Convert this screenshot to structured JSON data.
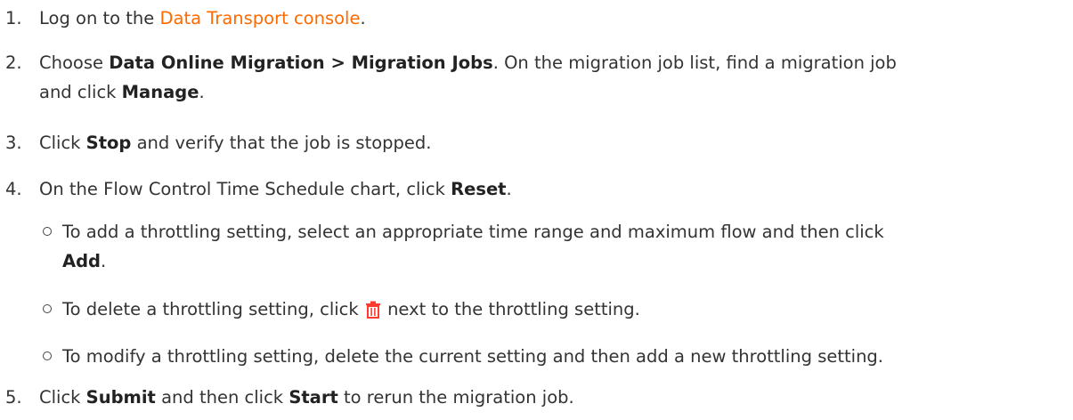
{
  "steps": [
    {
      "num": "1.",
      "t1": "Log on to the ",
      "link": "Data Transport console",
      "t2": "."
    },
    {
      "num": "2.",
      "t1": "Choose ",
      "b1": "Data Online Migration > Migration Jobs",
      "t2": ". On the migration job list, find a migration job",
      "t3": "and click ",
      "b2": "Manage",
      "t4": "."
    },
    {
      "num": "3.",
      "t1": "Click ",
      "b1": "Stop",
      "t2": " and verify that the job is stopped."
    },
    {
      "num": "4.",
      "t1": "On the Flow Control Time Schedule chart, click ",
      "b1": "Reset",
      "t2": ".",
      "subitems": [
        {
          "t1": "To add a throttling setting, select an appropriate time range and maximum flow and then click",
          "b1": "Add",
          "t2": "."
        },
        {
          "t1": "To delete a throttling setting, click ",
          "icon": "trash-icon",
          "t2": " next to the throttling setting."
        },
        {
          "t1": "To modify a throttling setting, delete the current setting and then add a new throttling setting."
        }
      ]
    },
    {
      "num": "5.",
      "t1": "Click ",
      "b1": "Submit",
      "t2": " and then click ",
      "b2": "Start",
      "t3": " to rerun the migration job."
    }
  ],
  "colors": {
    "link": "#ff6a00",
    "text": "#333333",
    "icon": "#ff3b30"
  }
}
